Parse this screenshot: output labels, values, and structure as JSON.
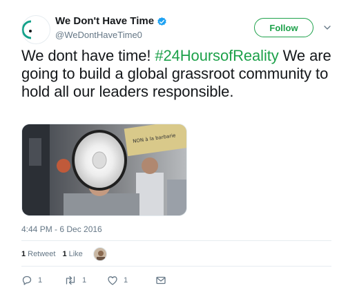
{
  "account": {
    "display_name": "We Don't Have Time",
    "handle": "@WeDontHaveTime0",
    "avatar_text": "We Don't Have Time.",
    "verified_icon": "verified-badge-icon"
  },
  "header": {
    "follow_label": "Follow",
    "caret_icon": "chevron-down-icon"
  },
  "tweet": {
    "text_before": "We dont have time! ",
    "hashtag": "#24HoursofReality",
    "text_after": " We are going to build a global grassroot community to hold all our leaders responsible.",
    "timestamp": "4:44 PM - 6 Dec 2016"
  },
  "stats": {
    "retweets_count": "1",
    "retweets_label": "Retweet",
    "likes_count": "1",
    "likes_label": "Like"
  },
  "actions": {
    "reply_count": "1",
    "retweet_count": "1",
    "like_count": "1"
  },
  "colors": {
    "accent": "#1da14a",
    "muted": "#657786",
    "verified": "#1da1f2",
    "divider": "#e6ecf0"
  }
}
